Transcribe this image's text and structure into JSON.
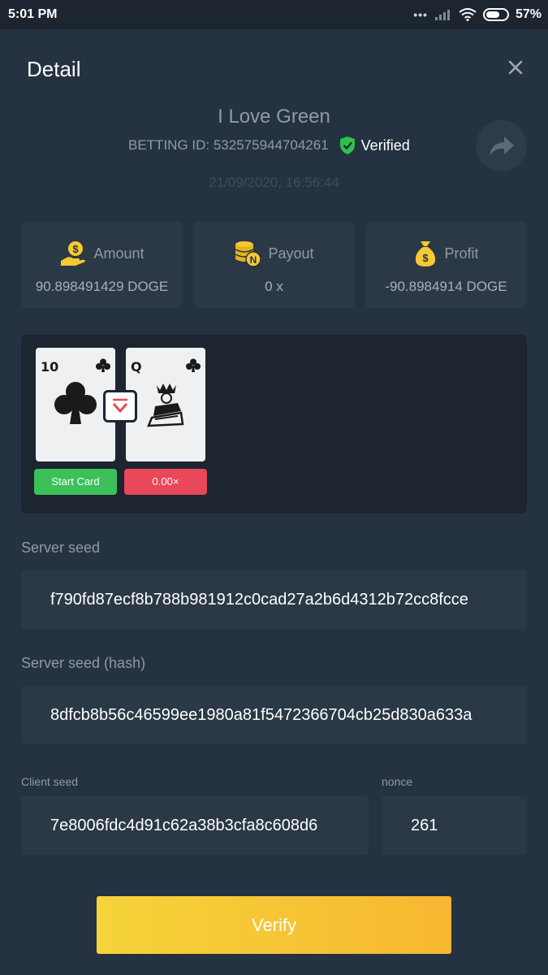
{
  "status": {
    "time": "5:01 PM",
    "battery": "57%"
  },
  "header": {
    "title": "Detail",
    "close_icon": "close-icon"
  },
  "bet": {
    "game_name": "I Love Green",
    "betting_id": "BETTING ID: 532575944704261",
    "verified_label": "Verified",
    "datetime": "21/09/2020, 16:56:44"
  },
  "stats": [
    {
      "icon": "hand-coin-icon",
      "label": "Amount",
      "value": "90.898491429 DOGE"
    },
    {
      "icon": "coin-stack-icon",
      "label": "Payout",
      "value": "0 x"
    },
    {
      "icon": "money-bag-icon",
      "label": "Profit",
      "value": "-90.8984914 DOGE"
    }
  ],
  "game": {
    "cards": [
      {
        "rank": "10",
        "suit": "clubs"
      },
      {
        "rank": "Q",
        "suit": "clubs"
      }
    ],
    "start_label": "Start Card",
    "multiplier_label": "0.00×",
    "colors": {
      "start": "#3cc15a",
      "multiplier": "#e8485a",
      "arrow": "#e8485a"
    }
  },
  "seeds": {
    "server_seed_label": "Server seed",
    "server_seed": "f790fd87ecf8b788b981912c0cad27a2b6d4312b72cc8fcce",
    "server_hash_label": "Server seed (hash)",
    "server_hash": "8dfcb8b56c46599ee1980a81f5472366704cb25d830a633a",
    "client_seed_label": "Client seed",
    "client_seed": "7e8006fdc4d91c62a38b3cfa8c608d6",
    "nonce_label": "nonce",
    "nonce": "261"
  },
  "verify_label": "Verify",
  "accent": "#f6c933"
}
